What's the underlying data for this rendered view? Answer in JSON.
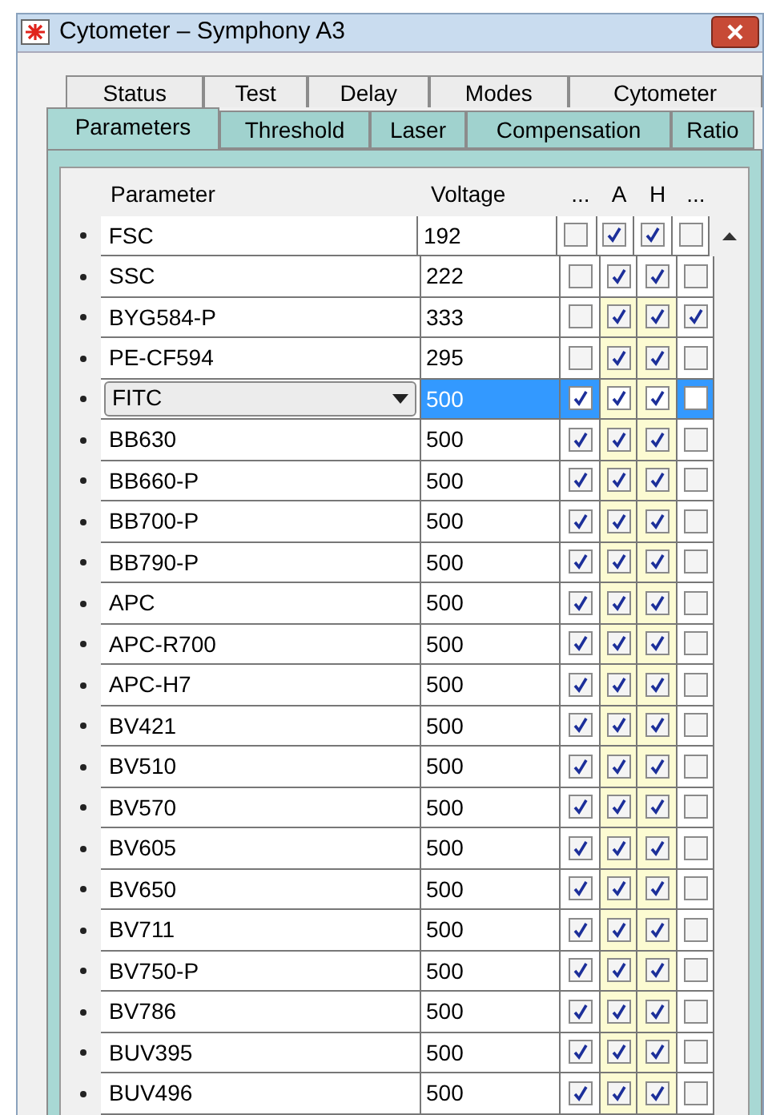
{
  "window": {
    "title": "Cytometer – Symphony A3"
  },
  "tabs_back": [
    {
      "label": "Status",
      "selected": false
    },
    {
      "label": "Test",
      "selected": false
    },
    {
      "label": "Delay",
      "selected": false
    },
    {
      "label": "Modes",
      "selected": false
    },
    {
      "label": "Cytometer",
      "selected": false
    }
  ],
  "tabs_front": [
    {
      "label": "Parameters",
      "selected": true
    },
    {
      "label": "Threshold",
      "selected": false
    },
    {
      "label": "Laser",
      "selected": false
    },
    {
      "label": "Compensation",
      "selected": false
    },
    {
      "label": "Ratio",
      "selected": false
    }
  ],
  "table": {
    "columns": [
      "Parameter",
      "Voltage",
      "...",
      "A",
      "H",
      "..."
    ],
    "rows": [
      {
        "parameter": "FSC",
        "voltage": "192",
        "selected": false,
        "shaded": false,
        "checks": [
          false,
          true,
          true,
          false
        ]
      },
      {
        "parameter": "SSC",
        "voltage": "222",
        "selected": false,
        "shaded": false,
        "checks": [
          false,
          true,
          true,
          false
        ]
      },
      {
        "parameter": "BYG584-P",
        "voltage": "333",
        "selected": false,
        "shaded": true,
        "checks": [
          false,
          true,
          true,
          true
        ]
      },
      {
        "parameter": "PE-CF594",
        "voltage": "295",
        "selected": false,
        "shaded": true,
        "checks": [
          false,
          true,
          true,
          false
        ]
      },
      {
        "parameter": "FITC",
        "voltage": "500",
        "selected": true,
        "shaded": true,
        "checks": [
          true,
          true,
          true,
          false
        ]
      },
      {
        "parameter": "BB630",
        "voltage": "500",
        "selected": false,
        "shaded": true,
        "checks": [
          true,
          true,
          true,
          false
        ]
      },
      {
        "parameter": "BB660-P",
        "voltage": "500",
        "selected": false,
        "shaded": true,
        "checks": [
          true,
          true,
          true,
          false
        ]
      },
      {
        "parameter": "BB700-P",
        "voltage": "500",
        "selected": false,
        "shaded": true,
        "checks": [
          true,
          true,
          true,
          false
        ]
      },
      {
        "parameter": "BB790-P",
        "voltage": "500",
        "selected": false,
        "shaded": true,
        "checks": [
          true,
          true,
          true,
          false
        ]
      },
      {
        "parameter": "APC",
        "voltage": "500",
        "selected": false,
        "shaded": true,
        "checks": [
          true,
          true,
          true,
          false
        ]
      },
      {
        "parameter": "APC-R700",
        "voltage": "500",
        "selected": false,
        "shaded": true,
        "checks": [
          true,
          true,
          true,
          false
        ]
      },
      {
        "parameter": "APC-H7",
        "voltage": "500",
        "selected": false,
        "shaded": true,
        "checks": [
          true,
          true,
          true,
          false
        ]
      },
      {
        "parameter": "BV421",
        "voltage": "500",
        "selected": false,
        "shaded": true,
        "checks": [
          true,
          true,
          true,
          false
        ]
      },
      {
        "parameter": "BV510",
        "voltage": "500",
        "selected": false,
        "shaded": true,
        "checks": [
          true,
          true,
          true,
          false
        ]
      },
      {
        "parameter": "BV570",
        "voltage": "500",
        "selected": false,
        "shaded": true,
        "checks": [
          true,
          true,
          true,
          false
        ]
      },
      {
        "parameter": "BV605",
        "voltage": "500",
        "selected": false,
        "shaded": true,
        "checks": [
          true,
          true,
          true,
          false
        ]
      },
      {
        "parameter": "BV650",
        "voltage": "500",
        "selected": false,
        "shaded": true,
        "checks": [
          true,
          true,
          true,
          false
        ]
      },
      {
        "parameter": "BV711",
        "voltage": "500",
        "selected": false,
        "shaded": true,
        "checks": [
          true,
          true,
          true,
          false
        ]
      },
      {
        "parameter": "BV750-P",
        "voltage": "500",
        "selected": false,
        "shaded": true,
        "checks": [
          true,
          true,
          true,
          false
        ]
      },
      {
        "parameter": "BV786",
        "voltage": "500",
        "selected": false,
        "shaded": true,
        "checks": [
          true,
          true,
          true,
          false
        ]
      },
      {
        "parameter": "BUV395",
        "voltage": "500",
        "selected": false,
        "shaded": true,
        "checks": [
          true,
          true,
          true,
          false
        ]
      },
      {
        "parameter": "BUV496",
        "voltage": "500",
        "selected": false,
        "shaded": true,
        "checks": [
          true,
          true,
          true,
          false
        ]
      }
    ]
  }
}
